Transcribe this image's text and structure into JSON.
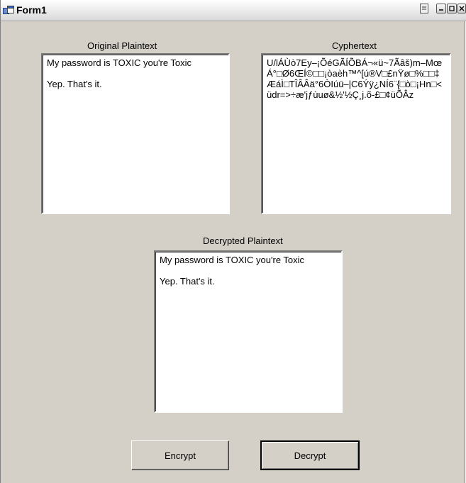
{
  "window": {
    "title": "Form1"
  },
  "labels": {
    "original": "Original Plaintext",
    "cypher": "Cyphertext",
    "decrypted": "Decrypted Plaintext"
  },
  "textboxes": {
    "original_value": "My password is TOXIC you're Toxic\n\nYep. That's it.",
    "cypher_value": "U/lÁÙò7Ey–¡ÕéGÃÍÕBÁ¬«ü~7Ãâš)m–MœÁ°□Ø6ŒÍ©□□¡òaèh™^[ú®V□£nŸø□%□□‡ÆáÌ□TÎÂÂä°6ÒIúü–|C6Ýÿ¿NÍ6¨{□ò□¡Hn□<üdr=>÷æ'jƒùuø&½'½Ç¸j.õ-£□¢üÕÂz",
    "decrypted_value": "My password is TOXIC you're Toxic\n\nYep. That's it."
  },
  "buttons": {
    "encrypt": "Encrypt",
    "decrypt": "Decrypt"
  }
}
